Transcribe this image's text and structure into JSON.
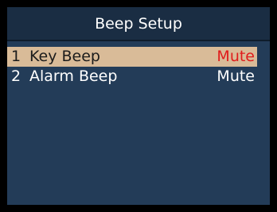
{
  "header": {
    "title": "Beep Setup"
  },
  "menu": {
    "items": [
      {
        "number": "1",
        "label": "Key Beep",
        "value": "Mute",
        "selected": true
      },
      {
        "number": "2",
        "label": "Alarm Beep",
        "value": "Mute",
        "selected": false
      }
    ]
  },
  "colors": {
    "background": "#233c58",
    "title_bar": "#1a2d43",
    "selection_highlight": "#d9bb98",
    "selected_value": "#e01b1b",
    "text": "#ffffff"
  }
}
